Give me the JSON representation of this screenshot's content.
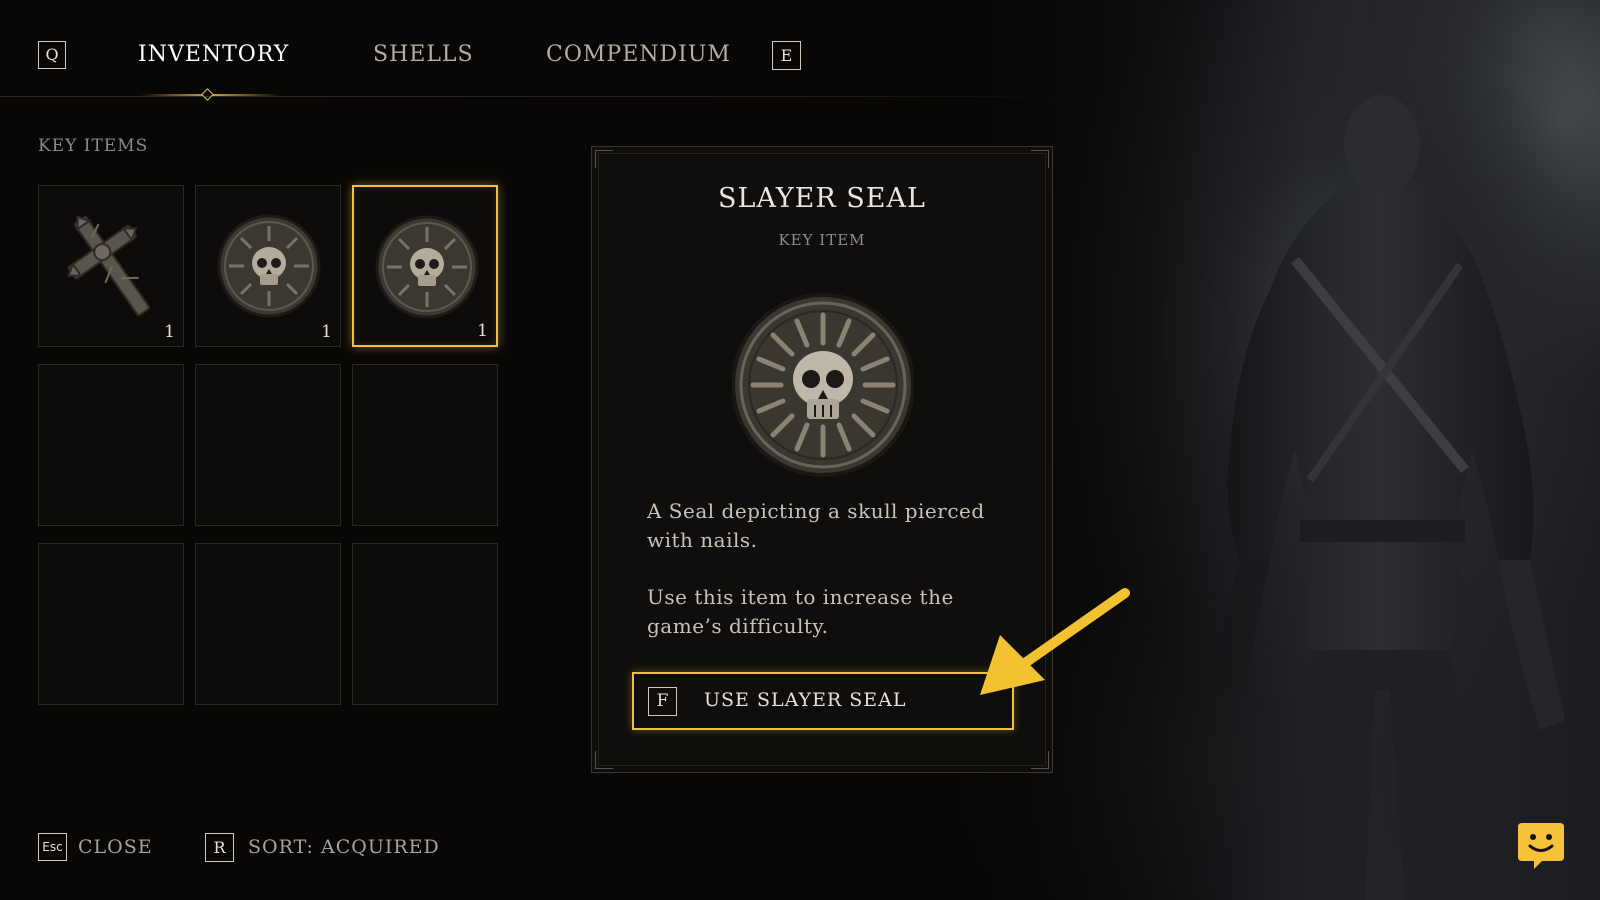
{
  "tabs": {
    "prev_key": "Q",
    "next_key": "E",
    "items": [
      {
        "label": "INVENTORY",
        "active": true
      },
      {
        "label": "SHELLS",
        "active": false
      },
      {
        "label": "COMPENDIUM",
        "active": false
      }
    ]
  },
  "key_items": {
    "label": "KEY ITEMS",
    "slots": [
      {
        "icon": "spiked-cross-icon",
        "count": "1",
        "selected": false
      },
      {
        "icon": "slayer-seal-icon",
        "count": "1",
        "selected": false
      },
      {
        "icon": "slayer-seal-icon",
        "count": "1",
        "selected": true
      },
      {
        "empty": true
      },
      {
        "empty": true
      },
      {
        "empty": true
      },
      {
        "empty": true
      },
      {
        "empty": true
      },
      {
        "empty": true
      }
    ]
  },
  "detail": {
    "title": "SLAYER SEAL",
    "type": "KEY ITEM",
    "icon": "slayer-seal-icon",
    "description_1": "A Seal depicting a skull pierced with nails.",
    "description_2": "Use this item to increase the game’s difficulty.",
    "action_key": "F",
    "action_label": "USE SLAYER SEAL"
  },
  "hints": {
    "close_key": "Esc",
    "close_label": "CLOSE",
    "sort_key": "R",
    "sort_label": "SORT: ACQUIRED"
  },
  "colors": {
    "accent": "#f0c040",
    "arrow": "#f2c230",
    "chat": "#f5c23a"
  }
}
